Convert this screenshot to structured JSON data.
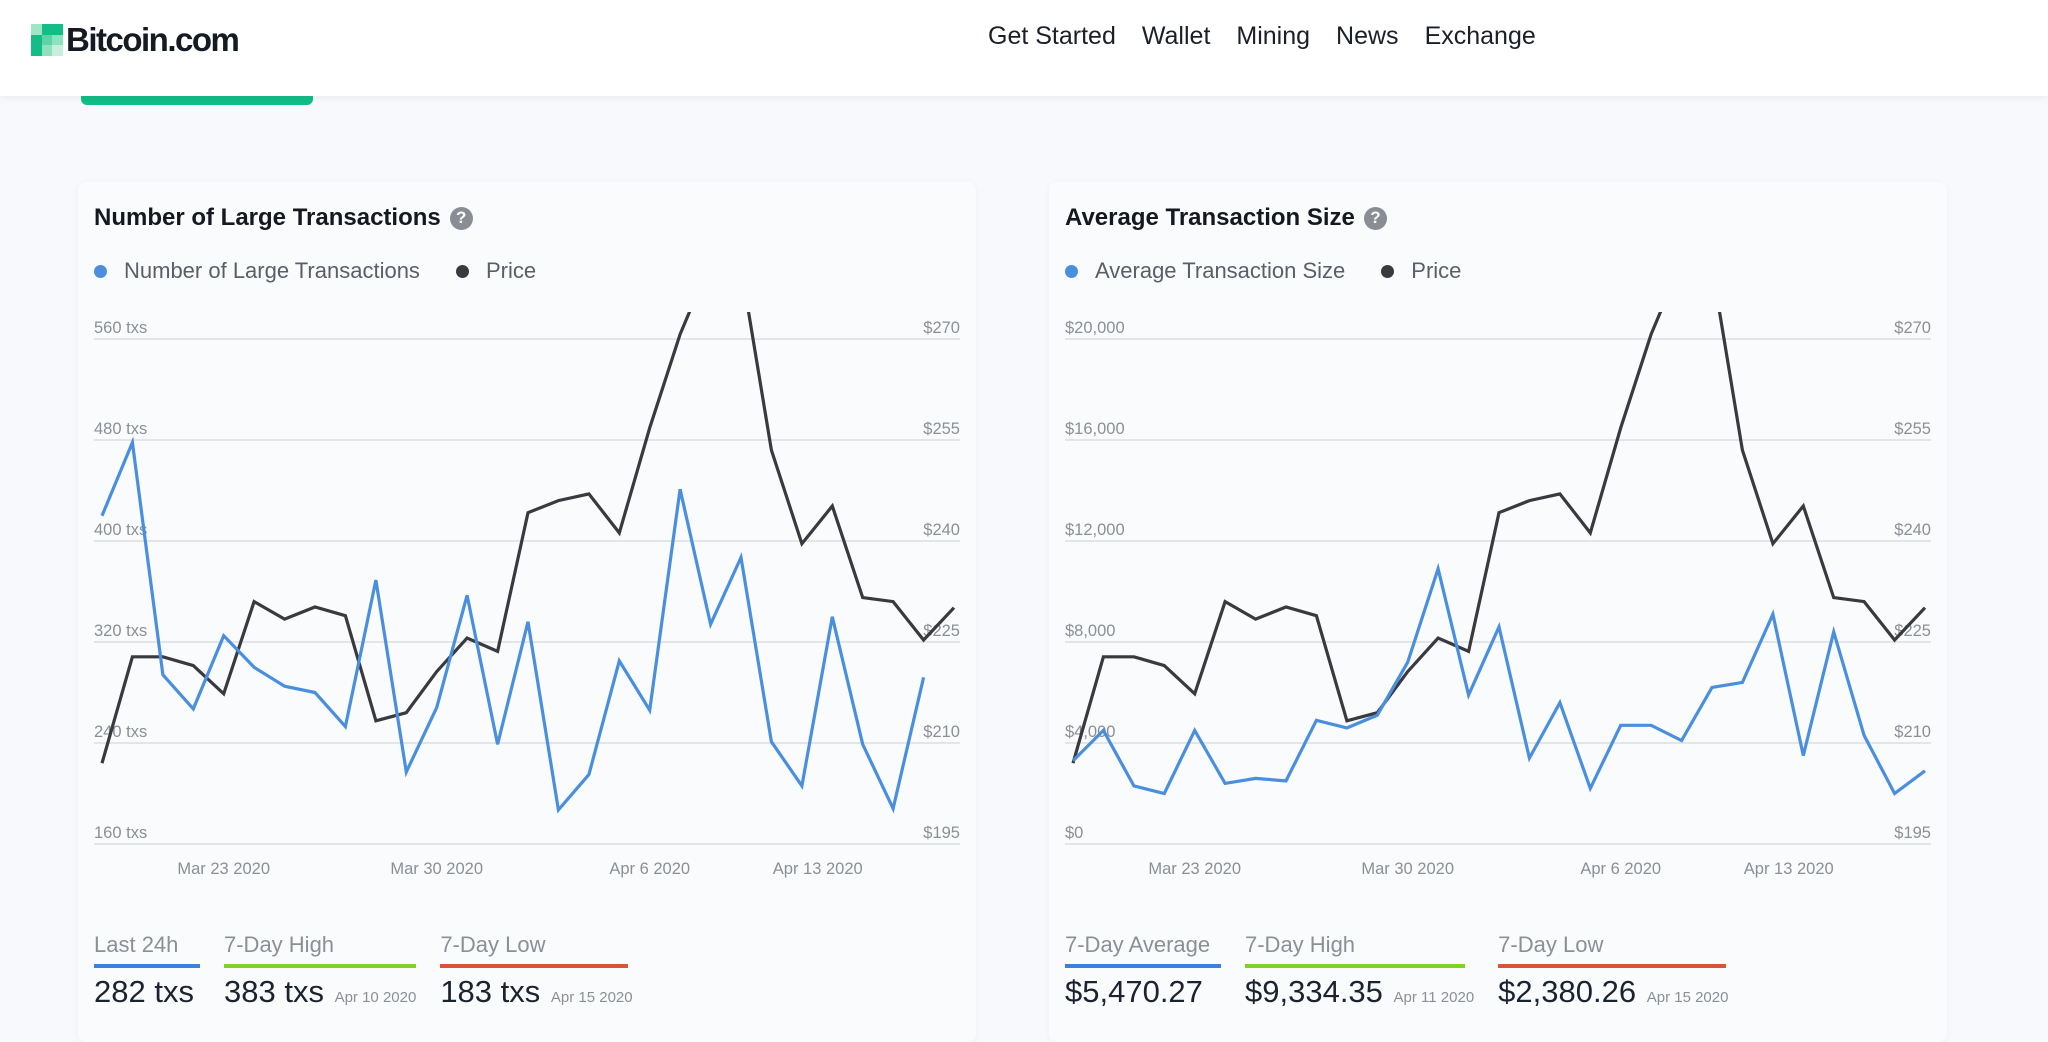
{
  "header": {
    "logo_text": "Bitcoin.com",
    "nav": [
      "Get Started",
      "Wallet",
      "Mining",
      "News",
      "Exchange"
    ]
  },
  "colors": {
    "brand_green": "#12bd86",
    "series_blue": "#4a8fde",
    "price_dark": "#383a3f",
    "stat_blue": "#3d7fdc",
    "stat_green": "#7ed321",
    "stat_red": "#d9533b"
  },
  "cards": [
    {
      "title": "Number of Large Transactions",
      "help_icon": "?",
      "legend": [
        "Number of Large Transactions",
        "Price"
      ],
      "stats": [
        {
          "label": "Last 24h",
          "value": "282 txs",
          "date": ""
        },
        {
          "label": "7-Day High",
          "value": "383 txs",
          "date": "Apr 10 2020"
        },
        {
          "label": "7-Day Low",
          "value": "183 txs",
          "date": "Apr 15 2020"
        }
      ]
    },
    {
      "title": "Average Transaction Size",
      "help_icon": "?",
      "legend": [
        "Average Transaction Size",
        "Price"
      ],
      "stats": [
        {
          "label": "7-Day Average",
          "value": "$5,470.27",
          "date": ""
        },
        {
          "label": "7-Day High",
          "value": "$9,334.35",
          "date": "Apr 11 2020"
        },
        {
          "label": "7-Day Low",
          "value": "$2,380.26",
          "date": "Apr 15 2020"
        }
      ]
    }
  ],
  "chart_data": [
    {
      "type": "line",
      "title": "Number of Large Transactions",
      "x_ticks": [
        "Mar 23 2020",
        "Mar 30 2020",
        "Apr 6 2020",
        "Apr 13 2020"
      ],
      "x_tick_index": [
        4,
        11,
        18,
        25
      ],
      "y_left": {
        "ticks": [
          "560 txs",
          "480 txs",
          "400 txs",
          "320 txs",
          "240 txs",
          "160 txs"
        ],
        "range": [
          160,
          560
        ]
      },
      "y_right": {
        "ticks": [
          "$270",
          "$255",
          "$240",
          "$225",
          "$210",
          "$195"
        ],
        "range": [
          195,
          270
        ]
      },
      "grid": true,
      "legend_position": "top-left",
      "series": [
        {
          "name": "Number of Large Transactions",
          "axis": "left",
          "values": [
            420,
            478,
            294,
            267,
            325,
            300,
            285,
            280,
            253,
            369,
            217,
            268,
            357,
            239,
            336,
            187,
            215,
            305,
            266,
            441,
            334,
            387,
            241,
            206,
            340,
            239,
            188,
            292
          ]
        },
        {
          "name": "Price",
          "axis": "right",
          "values": [
            207,
            222.8,
            222.8,
            221.5,
            217.3,
            231,
            228.4,
            230.2,
            228.9,
            213.3,
            214.5,
            220.6,
            225.6,
            223.6,
            244.2,
            246,
            247,
            241.2,
            256.8,
            270.7,
            281.5,
            280.8,
            253.5,
            239.6,
            245.2,
            231.6,
            231,
            225.3,
            230.1
          ]
        }
      ]
    },
    {
      "type": "line",
      "title": "Average Transaction Size",
      "x_ticks": [
        "Mar 23 2020",
        "Mar 30 2020",
        "Apr 6 2020",
        "Apr 13 2020"
      ],
      "x_tick_index": [
        4,
        11,
        18,
        25
      ],
      "y_left": {
        "ticks": [
          "$20,000",
          "$16,000",
          "$12,000",
          "$8,000",
          "$4,000",
          "$0"
        ],
        "range": [
          0,
          20000
        ]
      },
      "y_right": {
        "ticks": [
          "$270",
          "$255",
          "$240",
          "$225",
          "$210",
          "$195"
        ],
        "range": [
          195,
          270
        ]
      },
      "grid": true,
      "legend_position": "top-left",
      "series": [
        {
          "name": "Average Transaction Size",
          "axis": "left",
          "values": [
            3300,
            4500,
            2300,
            2000,
            4500,
            2400,
            2600,
            2500,
            4900,
            4600,
            5100,
            7200,
            10900,
            5900,
            8600,
            3400,
            5600,
            2200,
            4700,
            4700,
            4100,
            6200,
            6400,
            9100,
            3500,
            8400,
            4300,
            2000,
            2900
          ]
        },
        {
          "name": "Price",
          "axis": "right",
          "values": [
            207,
            222.8,
            222.8,
            221.5,
            217.3,
            231,
            228.4,
            230.2,
            228.9,
            213.3,
            214.5,
            220.6,
            225.6,
            223.6,
            244.2,
            246,
            247,
            241.2,
            256.8,
            270.7,
            281.5,
            280.8,
            253.5,
            239.6,
            245.2,
            231.6,
            231,
            225.3,
            230.1
          ]
        }
      ]
    }
  ]
}
